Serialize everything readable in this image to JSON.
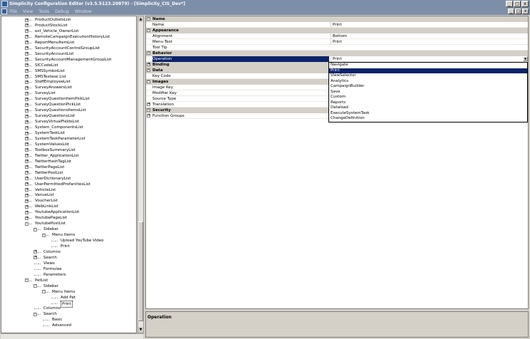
{
  "window": {
    "title": "Simplicity Configuration Editor (v3.5.5123.20879) - [Simplicity_CIS_Dev*]",
    "minimize": "_",
    "maximize": "□",
    "close": "x"
  },
  "menu": {
    "items": [
      "File",
      "View",
      "Tools",
      "Debug",
      "Window"
    ]
  },
  "tree": {
    "items": [
      {
        "label": "ProductOutletsList",
        "level": 1,
        "exp": "+"
      },
      {
        "label": "ProductStockList",
        "level": 1,
        "exp": "+"
      },
      {
        "label": "ext_Vehicle_OwnerList",
        "level": 1,
        "exp": "+"
      },
      {
        "label": "RemoteCampaignExecutionHistoryList",
        "level": 1,
        "exp": "+"
      },
      {
        "label": "ReportMenuItemList",
        "level": 1,
        "exp": "+"
      },
      {
        "label": "SecurityAccountControlGroupList",
        "level": 1,
        "exp": "+"
      },
      {
        "label": "SecurityAccountList",
        "level": 1,
        "exp": "+"
      },
      {
        "label": "SecurityAccountManagementGroupList",
        "level": 1,
        "exp": "+"
      },
      {
        "label": "SICCodeList",
        "level": 1,
        "exp": "+"
      },
      {
        "label": "SMSSymbolList",
        "level": 1,
        "exp": "+"
      },
      {
        "label": "SMSTextese List",
        "level": 1,
        "exp": "+"
      },
      {
        "label": "StaffEmployeeList",
        "level": 1,
        "exp": "+"
      },
      {
        "label": "SurveyAnswersList",
        "level": 1,
        "exp": "+"
      },
      {
        "label": "SurveyList",
        "level": 1,
        "exp": "+"
      },
      {
        "label": "SurveyQuestionItemPickList",
        "level": 1,
        "exp": "+"
      },
      {
        "label": "SurveyQuestionPickList",
        "level": 1,
        "exp": "+"
      },
      {
        "label": "SurveyQuestionsItemsList",
        "level": 1,
        "exp": "+"
      },
      {
        "label": "SurveyQuestionsList",
        "level": 1,
        "exp": "+"
      },
      {
        "label": "SurveyVirtualFieldsList",
        "level": 1,
        "exp": "+"
      },
      {
        "label": "System_ComponentsList",
        "level": 1,
        "exp": "+"
      },
      {
        "label": "SystemTaskList",
        "level": 1,
        "exp": "+"
      },
      {
        "label": "SystemTaskParameterList",
        "level": 1,
        "exp": "+"
      },
      {
        "label": "SystemValuesList",
        "level": 1,
        "exp": "+"
      },
      {
        "label": "ToolboxSummaryList",
        "level": 1,
        "exp": "+"
      },
      {
        "label": "Twitter_ApplicationList",
        "level": 1,
        "exp": "+"
      },
      {
        "label": "TwitterHashTagList",
        "level": 1,
        "exp": "+"
      },
      {
        "label": "TwitterPageList",
        "level": 1,
        "exp": "+"
      },
      {
        "label": "TwitterPostList",
        "level": 1,
        "exp": "+"
      },
      {
        "label": "UserDictionaryList",
        "level": 1,
        "exp": "+"
      },
      {
        "label": "UserPermittedProfanitiesList",
        "level": 1,
        "exp": "+"
      },
      {
        "label": "VehicleList",
        "level": 1,
        "exp": "+"
      },
      {
        "label": "VenueList",
        "level": 1,
        "exp": "+"
      },
      {
        "label": "VoucherList",
        "level": 1,
        "exp": "+"
      },
      {
        "label": "WebLinkList",
        "level": 1,
        "exp": "+"
      },
      {
        "label": "YoutubeApplicationList",
        "level": 1,
        "exp": "+"
      },
      {
        "label": "YoutubePageList",
        "level": 1,
        "exp": "+"
      },
      {
        "label": "YoutubePostList",
        "level": 1,
        "exp": "-"
      },
      {
        "label": "Sidebar",
        "level": 2,
        "exp": "-"
      },
      {
        "label": "Menu Items",
        "level": 3,
        "exp": "-"
      },
      {
        "label": "Upload YouTube Video",
        "level": 4,
        "exp": ""
      },
      {
        "label": "Print",
        "level": 4,
        "exp": ""
      },
      {
        "label": "Columns",
        "level": 2,
        "exp": "+"
      },
      {
        "label": "Search",
        "level": 2,
        "exp": "+"
      },
      {
        "label": "Views",
        "level": 2,
        "exp": ""
      },
      {
        "label": "Formulae",
        "level": 2,
        "exp": ""
      },
      {
        "label": "Parameters",
        "level": 2,
        "exp": ""
      },
      {
        "label": "PetList",
        "level": 1,
        "exp": "-"
      },
      {
        "label": "Sidebar",
        "level": 2,
        "exp": "-"
      },
      {
        "label": "Menu Items",
        "level": 3,
        "exp": "-"
      },
      {
        "label": "Add Pet",
        "level": 4,
        "exp": ""
      },
      {
        "label": "Print",
        "level": 4,
        "exp": "",
        "selected": true
      },
      {
        "label": "Columns",
        "level": 2,
        "exp": ""
      },
      {
        "label": "Search",
        "level": 2,
        "exp": "-"
      },
      {
        "label": "Basic",
        "level": 3,
        "exp": ""
      },
      {
        "label": "Advanced",
        "level": 3,
        "exp": ""
      }
    ]
  },
  "properties": {
    "rows": [
      {
        "type": "cat",
        "name": "Name",
        "exp": "-"
      },
      {
        "type": "item",
        "name": "Name",
        "value": "Print"
      },
      {
        "type": "cat",
        "name": "Appearance",
        "exp": "-"
      },
      {
        "type": "item",
        "name": "Alignment",
        "value": "Bottom"
      },
      {
        "type": "item",
        "name": "Menu Text",
        "value": "Print"
      },
      {
        "type": "item",
        "name": "Tool Tip",
        "value": ""
      },
      {
        "type": "cat",
        "name": "Behavior",
        "exp": "-"
      },
      {
        "type": "item",
        "name": "Operation",
        "value": "Print",
        "selected": true
      },
      {
        "type": "cat",
        "name": "Binding",
        "exp": "+"
      },
      {
        "type": "cat",
        "name": "Data",
        "exp": "-"
      },
      {
        "type": "item",
        "name": "Key Code",
        "value": ""
      },
      {
        "type": "cat",
        "name": "Images",
        "exp": "-"
      },
      {
        "type": "item",
        "name": "Image Key",
        "value": ""
      },
      {
        "type": "item",
        "name": "Modifier Key",
        "value": ""
      },
      {
        "type": "item",
        "name": "Source Type",
        "value": ""
      },
      {
        "type": "item",
        "name": "Translation",
        "value": "",
        "exp": "+"
      },
      {
        "type": "cat",
        "name": "Security",
        "exp": "-"
      },
      {
        "type": "item",
        "name": "Function Groups",
        "value": "",
        "exp": "+"
      }
    ]
  },
  "dropdown": {
    "options": [
      "Navigate",
      "Print",
      "ViewSelector",
      "Analytics",
      "CampaignBuilder",
      "Save",
      "Custom",
      "Reports",
      "Dataload",
      "ExecuteSystemTask",
      "ChangeDefinition"
    ],
    "highlighted": 1
  },
  "description": {
    "title": "Operation"
  }
}
